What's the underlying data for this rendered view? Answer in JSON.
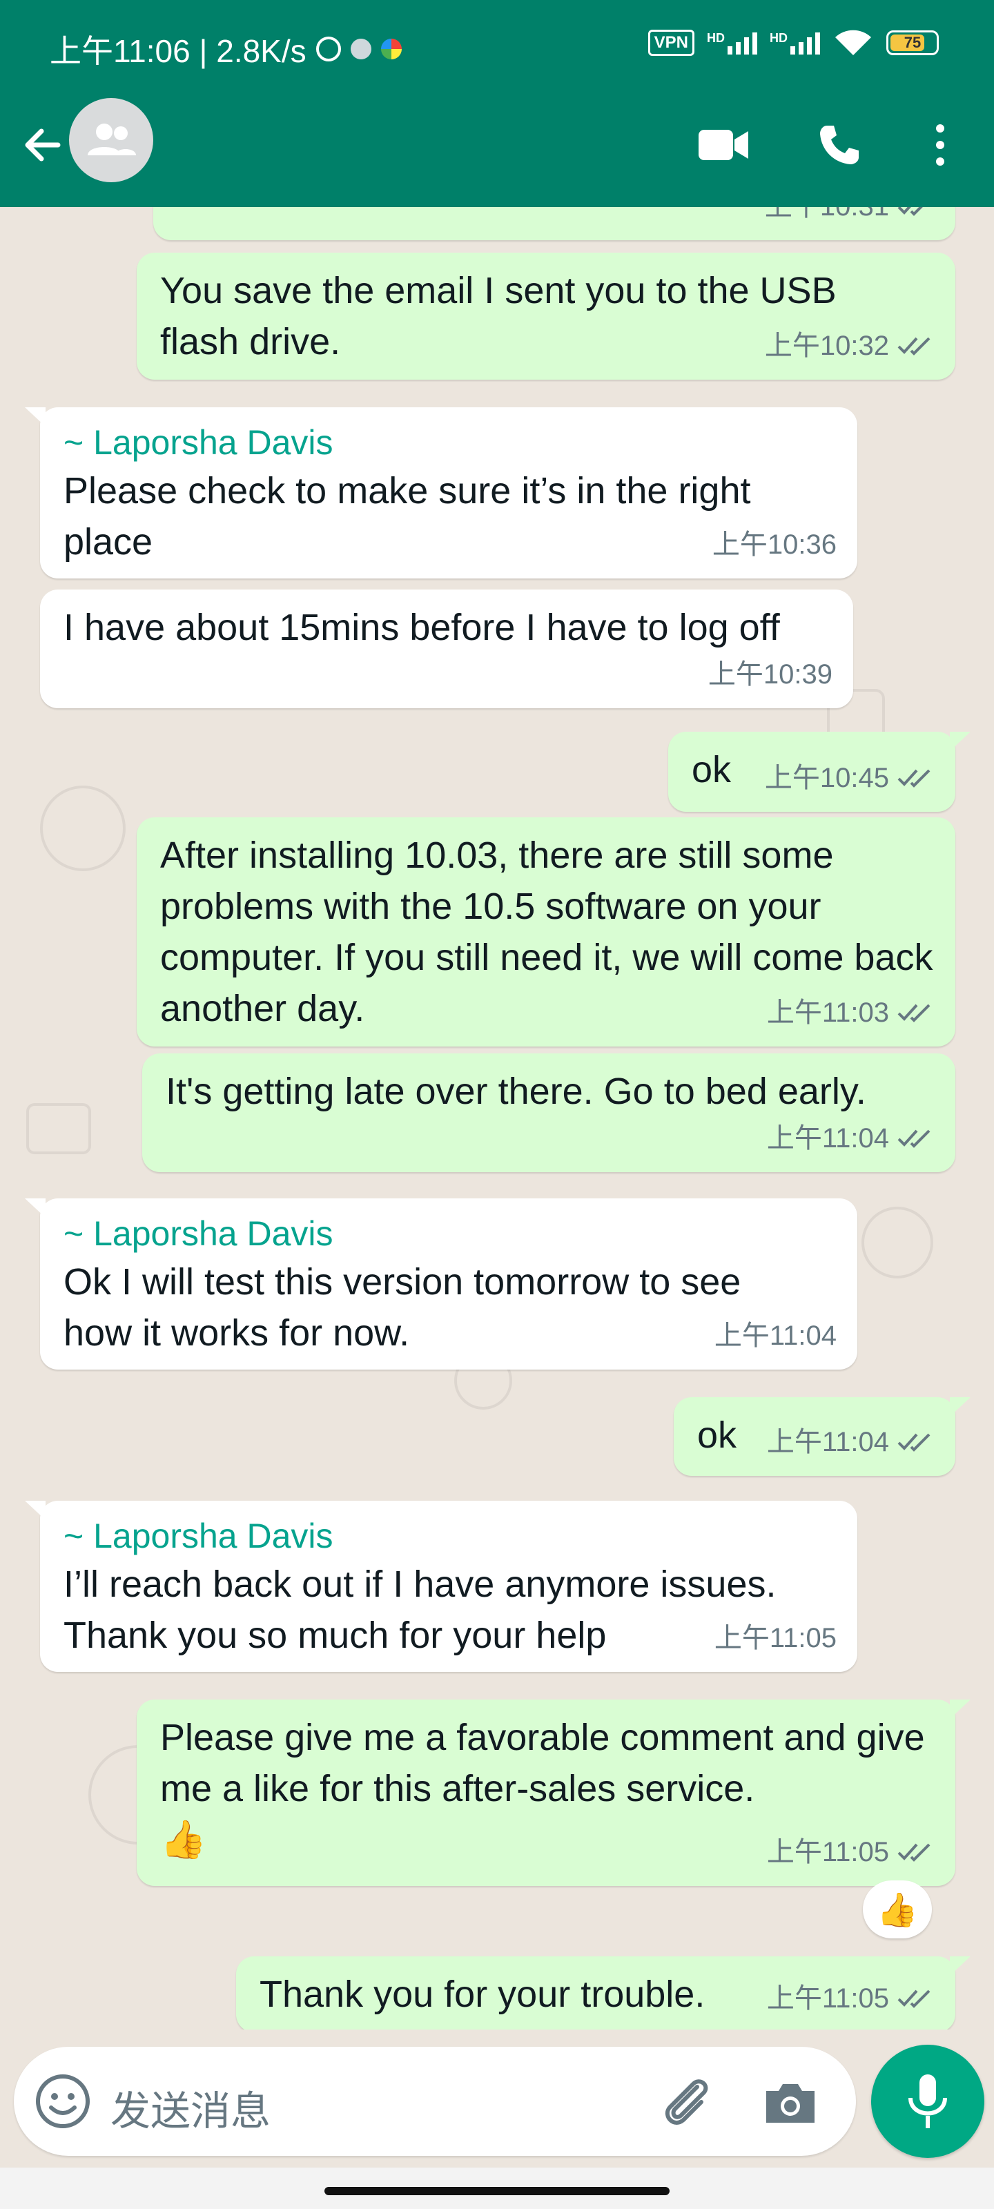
{
  "status_bar": {
    "time_speed": "上午11:06 | 2.8K/s",
    "vpn": "VPN",
    "hd1": "HD",
    "hd2": "HD",
    "battery": "75"
  },
  "header": {
    "back_icon": "arrow-left-icon",
    "avatar_icon": "group-icon",
    "video_icon": "video-camera-icon",
    "call_icon": "phone-icon",
    "menu_icon": "more-vertical-icon",
    "color": "#008069"
  },
  "messages": [
    {
      "dir": "out",
      "text": "",
      "time": "上午10:31",
      "ticks": "double-check-icon"
    },
    {
      "dir": "out",
      "text": "You save the email I sent you to the USB flash drive.",
      "time": "上午10:32",
      "ticks": "double-check-icon"
    },
    {
      "dir": "in",
      "sender": "~ Laporsha Davis",
      "text": "Please check to make sure it’s in the right place",
      "time": "上午10:36"
    },
    {
      "dir": "in",
      "text": "I have about 15mins before I have to log off",
      "time": "上午10:39"
    },
    {
      "dir": "out",
      "text": "ok",
      "time": "上午10:45",
      "ticks": "double-check-icon"
    },
    {
      "dir": "out",
      "text": "After installing 10.03, there are still some problems with the 10.5 software on your computer. If you still need it, we will come back another day.",
      "time": "上午11:03",
      "ticks": "double-check-icon"
    },
    {
      "dir": "out",
      "text": "It's getting late over there. Go to bed early.",
      "time": "上午11:04",
      "ticks": "double-check-icon"
    },
    {
      "dir": "in",
      "sender": "~ Laporsha Davis",
      "text": "Ok I will test this version tomorrow to see how it works for now.",
      "time": "上午11:04"
    },
    {
      "dir": "out",
      "text": "ok",
      "time": "上午11:04",
      "ticks": "double-check-icon"
    },
    {
      "dir": "in",
      "sender": "~ Laporsha Davis",
      "text": "I’ll reach back out if I have anymore issues. Thank you so much for your help",
      "time": "上午11:05"
    },
    {
      "dir": "out",
      "text": "Please give me a favorable comment and give me a like for this after-sales service.",
      "emoji": "👍",
      "time": "上午11:05",
      "ticks": "double-check-icon",
      "reaction": "👍"
    },
    {
      "dir": "out",
      "text": "Thank you for your trouble.",
      "time": "上午11:05",
      "ticks": "double-check-icon"
    }
  ],
  "input": {
    "placeholder": "发送消息",
    "emoji_icon": "emoji-icon",
    "attach_icon": "paperclip-icon",
    "camera_icon": "camera-icon",
    "mic_icon": "microphone-icon"
  },
  "colors": {
    "outgoing": "#d9fdd3",
    "incoming": "#ffffff",
    "sender": "#06a38e",
    "accent": "#00a884"
  }
}
